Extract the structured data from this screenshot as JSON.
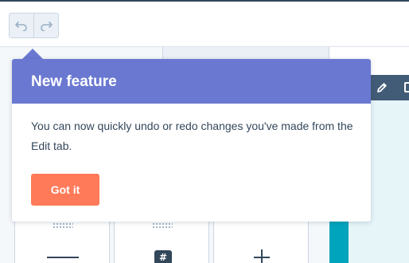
{
  "toolbar": {
    "undo_icon": "undo-icon",
    "redo_icon": "redo-icon"
  },
  "preview": {
    "edit_icon": "pencil-icon"
  },
  "modules": [
    {
      "icon": "divider-icon"
    },
    {
      "icon": "hash-icon",
      "glyph": "#"
    },
    {
      "icon": "plus-icon"
    }
  ],
  "popover": {
    "title": "New feature",
    "body": "You can now quickly undo or redo changes you've made from the Edit tab.",
    "button_label": "Got it"
  },
  "colors": {
    "header": "#6a78d1",
    "accent_button": "#ff7a59",
    "text": "#33475b",
    "preview_bar": "#425b76",
    "preview_teal": "#00a4bd"
  }
}
